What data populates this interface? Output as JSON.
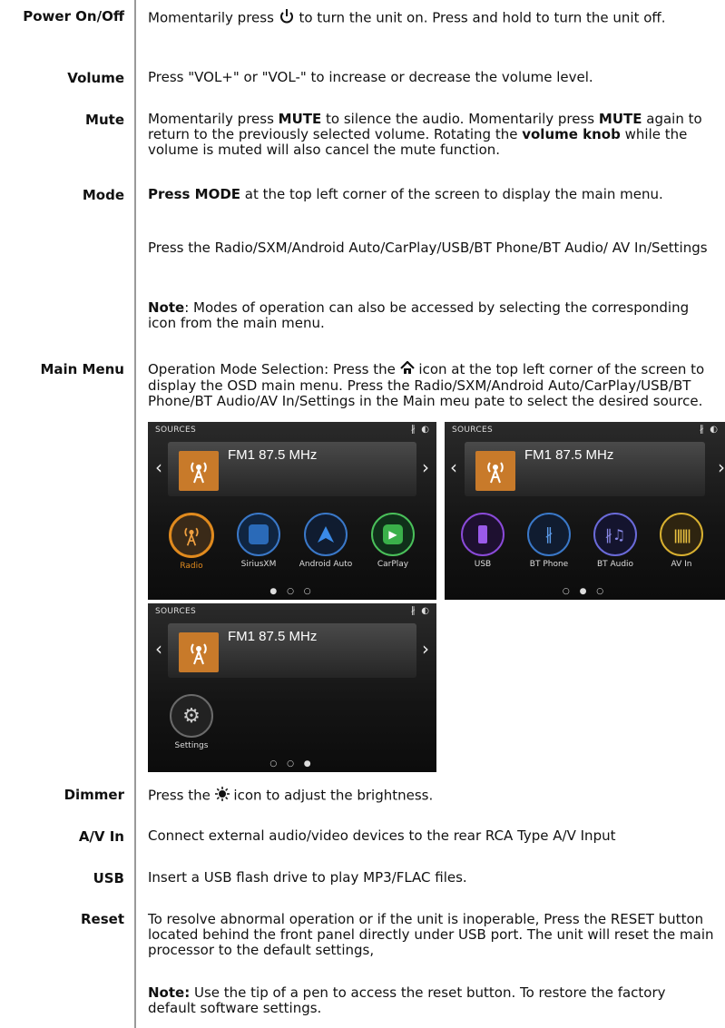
{
  "rows": [
    {
      "label": "Power On/Off",
      "text_a": "Momentarily press ",
      "text_b": " to turn the unit on. Press and hold to turn the unit off."
    },
    {
      "label": "Volume",
      "text": "Press \"VOL+\" or \"VOL-\" to increase or decrease the volume level."
    },
    {
      "label": "Mute",
      "t1": "Momentarily press ",
      "b1": "MUTE",
      "t2": " to silence the audio. Momentarily press ",
      "b2": "MUTE",
      "t3": " again to return to the previously selected volume. Rotating the ",
      "b3": "volume knob",
      "t4": " while the volume is muted will also cancel the mute function."
    },
    {
      "label": "Mode",
      "b1": "Press MODE",
      "t1": " at the top left corner of the screen to display the main menu.",
      "p2": "Press the Radio/SXM/Android Auto/CarPlay/USB/BT Phone/BT Audio/ AV In/Settings",
      "note_b": "Note",
      "note_t": ": Modes of operation can also be accessed by selecting the corresponding icon from the main menu."
    },
    {
      "label": "Main Menu",
      "t1": "Operation Mode Selection:  Press the ",
      "t2": " icon at the top left corner of the screen to display the OSD main menu.  Press the Radio/SXM/Android Auto/CarPlay/USB/BT Phone/BT Audio/AV In/Settings in the Main meu pate to select the desired source."
    },
    {
      "label": "Dimmer",
      "t1": "Press the ",
      "t2": " icon to adjust  the brightness."
    },
    {
      "label": "A/V In",
      "text": "Connect external audio/video devices to the rear RCA Type A/V Input"
    },
    {
      "label": "USB",
      "text": "Insert a USB flash drive to play MP3/FLAC files."
    },
    {
      "label": "Reset",
      "text": "To resolve abnormal operation or if the unit is inoperable, Press the RESET button located behind the front panel directly under USB port. The unit will reset the main processor to the default settings,",
      "note_b": "Note:",
      "note_t": " Use the tip of a pen to access the reset button. To restore the factory default software settings."
    }
  ],
  "screens": {
    "header": "SOURCES",
    "station": "FM1 87.5 MHz",
    "page1": [
      "Radio",
      "SiriusXM",
      "Android Auto",
      "CarPlay"
    ],
    "page2": [
      "USB",
      "BT Phone",
      "BT Audio",
      "AV In"
    ],
    "page3": [
      "Settings"
    ],
    "dots1": "● ○ ○",
    "dots2": "○ ● ○",
    "dots3": "○ ○ ●"
  },
  "icons": [
    "power-icon",
    "home-icon",
    "dimmer-icon",
    "bluetooth-icon",
    "radio-icon",
    "siriusxm-icon",
    "android-auto-icon",
    "carplay-icon",
    "usb-icon",
    "bt-phone-icon",
    "bt-audio-icon",
    "av-in-icon",
    "settings-icon"
  ],
  "colors": {
    "radio_ring": "#e08a1e",
    "tile_art": "#c87a2a",
    "rule": "#9a9a9a"
  }
}
